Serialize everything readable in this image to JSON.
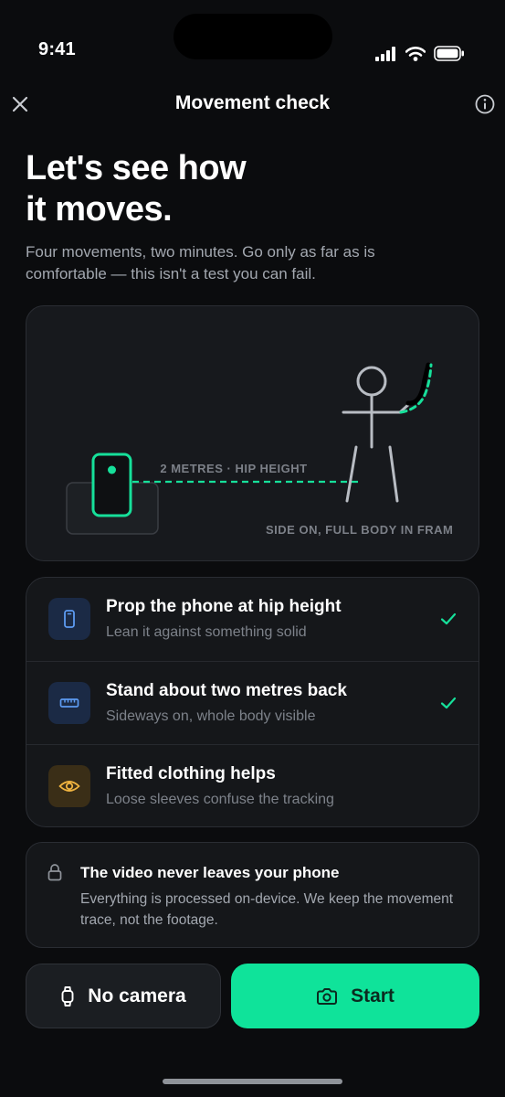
{
  "status": {
    "time": "9:41"
  },
  "nav": {
    "title": "Movement check"
  },
  "hero": {
    "headline": "Let's see how\nit moves.",
    "intro": "Four movements, two minutes. Go only as far as is comfortable — this isn't a test you can fail."
  },
  "illustration": {
    "distance_label": "2 METRES · HIP HEIGHT",
    "framing_label": "SIDE ON, FULL BODY IN FRAME"
  },
  "steps": [
    {
      "title": "Prop the phone at hip height",
      "subtitle": "Lean it against something solid",
      "icon": "phone-icon",
      "checked": true
    },
    {
      "title": "Stand about two metres back",
      "subtitle": "Sideways on, whole body visible",
      "icon": "ruler-icon",
      "checked": true
    },
    {
      "title": "Fitted clothing helps",
      "subtitle": "Loose sleeves confuse the tracking",
      "icon": "eye-icon",
      "checked": false
    }
  ],
  "privacy": {
    "title": "The video never leaves your phone",
    "body": "Everything is processed on-device. We keep the movement trace, not the footage."
  },
  "actions": {
    "secondary_label": "No camera",
    "primary_label": "Start"
  },
  "colors": {
    "accent": "#0fe39a",
    "background": "#0b0c0e",
    "card": "#15171a",
    "phone_icon_bg": "#1b2a45",
    "eye_icon_bg": "#3a2e17"
  }
}
